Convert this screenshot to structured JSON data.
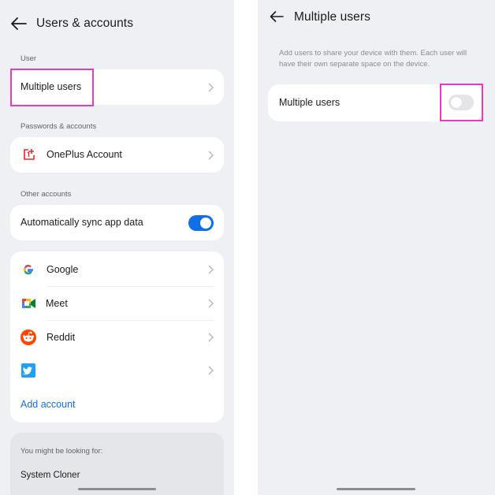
{
  "left_screen": {
    "title": "Users & accounts",
    "sections": {
      "user": "User",
      "passwords": "Passwords & accounts",
      "other": "Other accounts"
    },
    "multiple_users": "Multiple users",
    "oneplus_account": "OnePlus Account",
    "auto_sync": {
      "label": "Automatically sync app data",
      "on": true
    },
    "accounts": [
      {
        "label": "Google",
        "icon": "google-icon"
      },
      {
        "label": "Meet",
        "icon": "meet-icon"
      },
      {
        "label": "Reddit",
        "icon": "reddit-icon"
      },
      {
        "label": "",
        "icon": "twitter-icon"
      }
    ],
    "add_account": "Add account",
    "suggestions": {
      "heading": "You might be looking for:",
      "item": "System Cloner"
    }
  },
  "right_screen": {
    "title": "Multiple users",
    "description": "Add users to share your device with them. Each user will have their own separate space on the device.",
    "toggle": {
      "label": "Multiple users",
      "on": false
    }
  },
  "colors": {
    "accent": "#1170e8",
    "highlight": "#e23fbe",
    "oneplus": "#e8282b",
    "panel_bg": "#eef0f3"
  }
}
